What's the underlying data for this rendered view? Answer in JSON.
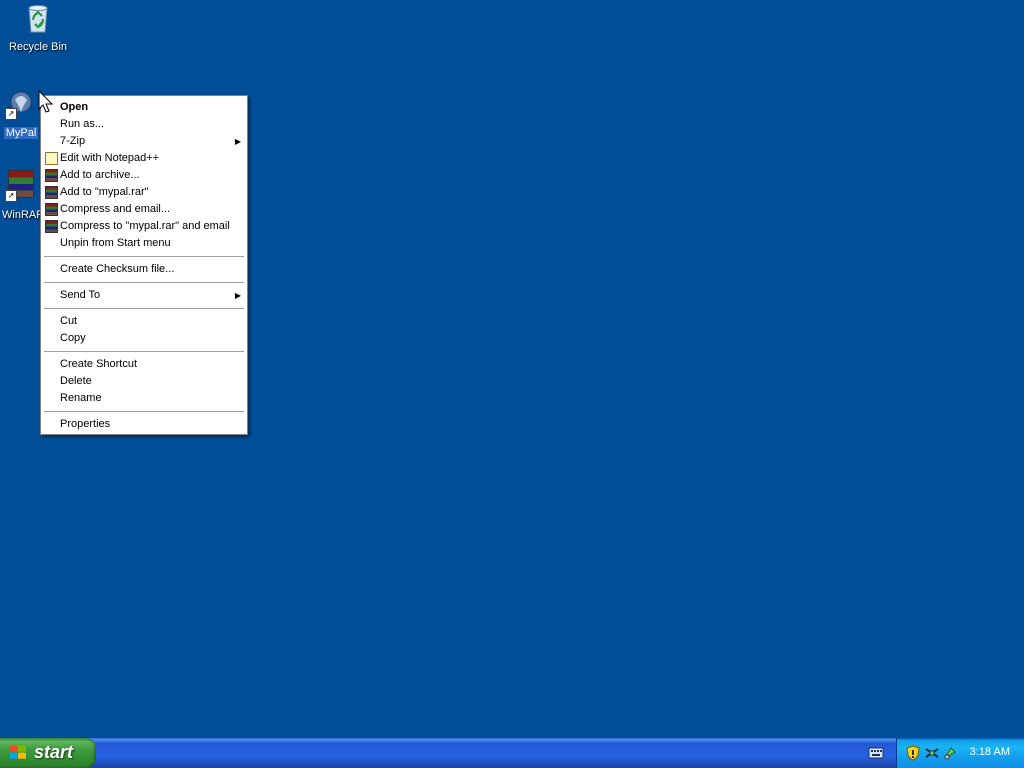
{
  "desktop": {
    "background_color": "#004e98",
    "icons": [
      {
        "label": "Recycle Bin"
      },
      {
        "label": "MyPal"
      },
      {
        "label": "WinRAR"
      }
    ]
  },
  "context_menu": {
    "items": [
      {
        "label": "Open"
      },
      {
        "label": "Run as..."
      },
      {
        "label": "7-Zip"
      },
      {
        "label": "Edit with Notepad++"
      },
      {
        "label": "Add to archive..."
      },
      {
        "label": "Add to \"mypal.rar\""
      },
      {
        "label": "Compress and email..."
      },
      {
        "label": "Compress to \"mypal.rar\" and email"
      },
      {
        "label": "Unpin from Start menu"
      },
      {
        "label": "Create Checksum file..."
      },
      {
        "label": "Send To"
      },
      {
        "label": "Cut"
      },
      {
        "label": "Copy"
      },
      {
        "label": "Create Shortcut"
      },
      {
        "label": "Delete"
      },
      {
        "label": "Rename"
      },
      {
        "label": "Properties"
      }
    ]
  },
  "taskbar": {
    "start_label": "start",
    "clock": "3:18 AM"
  }
}
